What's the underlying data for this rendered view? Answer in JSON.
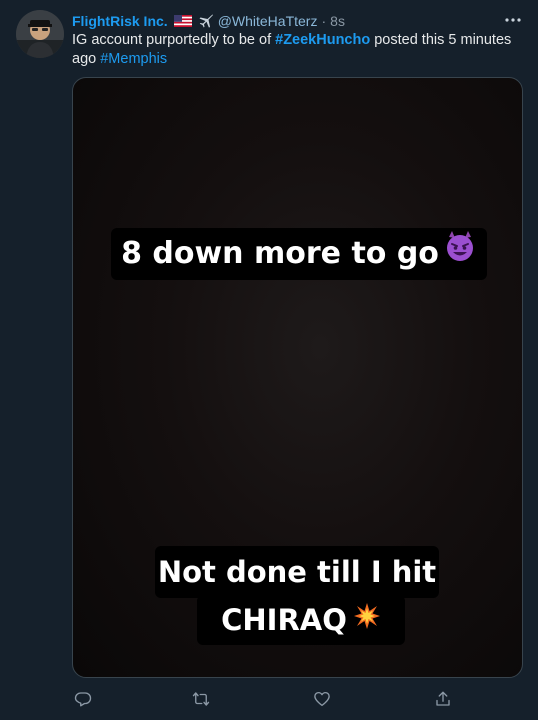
{
  "tweet": {
    "display_name": "FlightRisk Inc.",
    "handle": "@WhiteHaTterz",
    "separator": "·",
    "time": "8s",
    "text_parts": {
      "before_tag1": "IG account purportedly to be of ",
      "tag1": "#ZeekHuncho",
      "between": " posted this 5 minutes ago ",
      "tag2": "#Memphis"
    },
    "more_label": "···"
  },
  "media": {
    "caption_top": "8 down more to go",
    "caption_bottom_line1": "Not done till I hit",
    "caption_bottom_line2": "CHIRAQ"
  },
  "icons": {
    "header": [
      "us-flag-icon",
      "airplane-icon"
    ],
    "media": [
      "smiling-devil-icon",
      "collision-icon"
    ],
    "actions": [
      "reply-icon",
      "retweet-icon",
      "like-icon",
      "share-icon"
    ]
  },
  "colors": {
    "background": "#15202b",
    "accent": "#1d9bf0",
    "secondary_text": "#8b98a5",
    "primary_text": "#e7e9ea"
  }
}
